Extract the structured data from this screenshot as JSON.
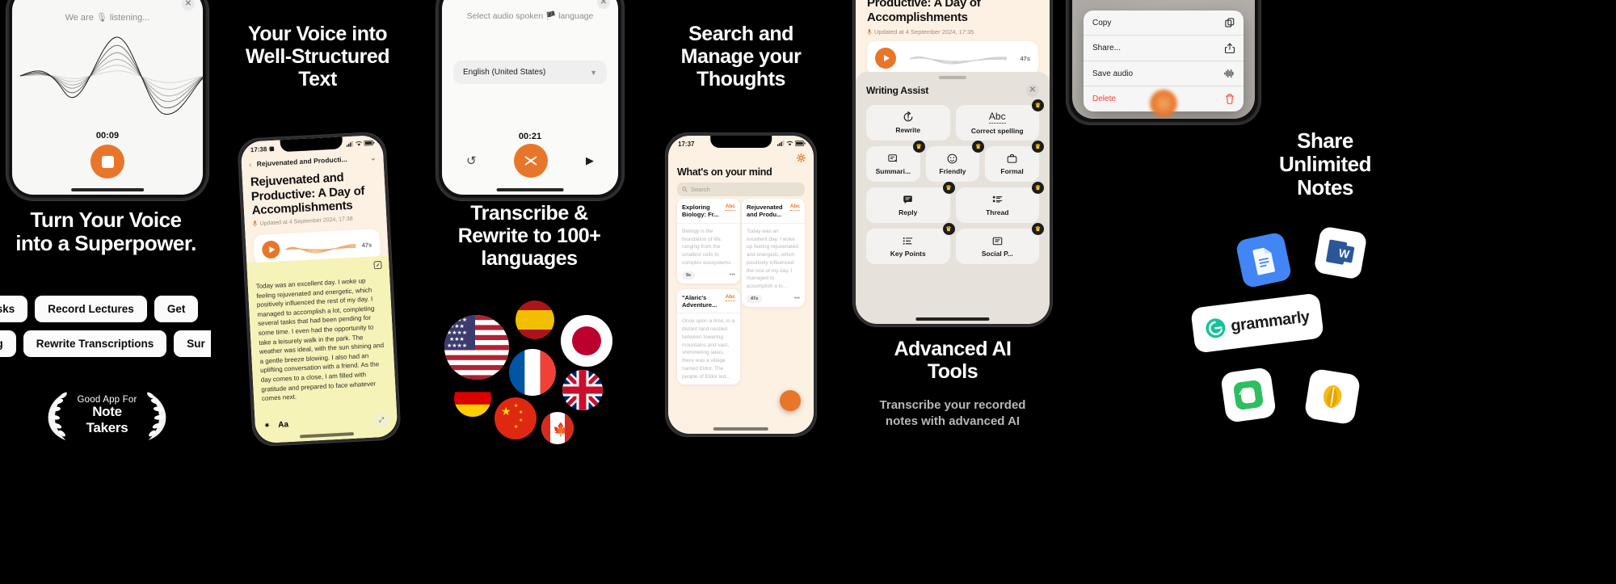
{
  "panels": [
    {
      "id": "voice-superpower",
      "headline": "Turn Your Voice\ninto a Superpower.",
      "recorder": {
        "listening_label": "We are 🎙 listening...",
        "timer": "00:09",
        "close_icon": "close-icon",
        "stop_icon": "stop-icon"
      },
      "chips": [
        "Tasks",
        "Record Lectures",
        "Get",
        "naling",
        "Rewrite Transcriptions",
        "Sur"
      ],
      "award": {
        "line1": "Good App For",
        "line2": "Note Takers"
      }
    },
    {
      "id": "voice-to-text",
      "headline": "Your Voice into\nWell-Structured\nText",
      "note": {
        "status_time": "17:38",
        "nav_back_icon": "chevron-left-icon",
        "nav_title": "Rejuvenated and Producti...",
        "nav_more_icon": "more-icon",
        "title": "Rejuvenated and Productive: A Day of Accomplishments",
        "meta_icon": "microphone-icon",
        "meta": "Updated at 4 September 2024, 17:38",
        "audio_duration": "47s",
        "play_icon": "play-icon",
        "edit_icon": "edit-icon",
        "body": "Today was an excellent day. I woke up feeling rejuvenated and energetic, which positively influenced the rest of my day. I managed to accomplish a lot, completing several tasks that had been pending for some time. I even had the opportunity to take a leisurely walk in the park. The weather was ideal, with the sun shining and a gentle breeze blowing. I also had an uplifting conversation with a friend. As the day comes to a close, I am filled with gratitude and prepared to face whatever comes next.",
        "toolbar_icons": [
          "sparkle-icon",
          "text-size-icon",
          "expand-icon"
        ],
        "toolbar_aa": "Aa"
      }
    },
    {
      "id": "transcribe-rewrite",
      "headline": "Transcribe &\nRewrite to 100+\nlanguages",
      "sheet": {
        "prompt": "Select audio spoken 🏴 language",
        "selected_language": "English (United States)",
        "dropdown_icon": "chevron-down-icon",
        "close_icon": "close-icon",
        "timer": "00:21",
        "undo_icon": "undo-icon",
        "transcribe_icon": "transcribe-icon",
        "play_icon": "play-icon"
      },
      "flags": [
        "usa",
        "spain",
        "japan",
        "france",
        "uk",
        "germany",
        "china",
        "canada"
      ]
    },
    {
      "id": "search-manage",
      "headline": "Search and\nManage your\nThoughts",
      "list": {
        "status_time": "17:37",
        "settings_icon": "gear-icon",
        "title": "What's on your mind",
        "search_placeholder": "Search",
        "search_icon": "search-icon",
        "add_icon": "plus-icon",
        "cards": [
          {
            "title": "Exploring Biology: Fr...",
            "badge": "Abc",
            "body": "Biology is the foundation of life, ranging from the smallest cells to complex ecosystems.",
            "duration": "9s",
            "more": "•••"
          },
          {
            "title": "Rejuvenated and Produ...",
            "badge": "Abc",
            "body": "Today was an excellent day. I woke up feeling rejuvenated and energetic, which positively influenced the rest of my day. I managed to accomplish a lo...",
            "duration": "47s",
            "more": "•••"
          },
          {
            "title": "\"Alaric's Adventure...",
            "badge": "Abc",
            "body": "Once upon a time, in a distant land nestled between towering mountains and vast, shimmering lakes, there was a village named Eldor. The people of Eldor led...",
            "duration": "",
            "more": ""
          }
        ]
      }
    },
    {
      "id": "advanced-ai",
      "headline": "Advanced AI\nTools",
      "subheadline": "Transcribe your recorded\nnotes with advanced AI",
      "note": {
        "title": "Productive: A Day of Accomplishments",
        "meta_icon": "microphone-icon",
        "meta": "Updated at 4 September 2024, 17:35",
        "play_icon": "play-icon",
        "audio_duration": "47s"
      },
      "writing_assist": {
        "title": "Writing Assist",
        "close_icon": "close-icon",
        "tiles": [
          {
            "label": "Rewrite",
            "icon": "rewrite-icon",
            "pro": false,
            "w": 2
          },
          {
            "label": "Correct spelling",
            "icon": "abc-icon",
            "pro": true,
            "w": 2
          },
          {
            "label": "Summari...",
            "icon": "summarize-icon",
            "pro": true,
            "w": 1
          },
          {
            "label": "Friendly",
            "icon": "smiley-icon",
            "pro": true,
            "w": 1
          },
          {
            "label": "Formal",
            "icon": "briefcase-icon",
            "pro": true,
            "w": 1
          },
          {
            "label": "Reply",
            "icon": "chat-bubble-icon",
            "pro": true,
            "w": 2
          },
          {
            "label": "Thread",
            "icon": "list-icon",
            "pro": true,
            "w": 2
          },
          {
            "label": "Key Points",
            "icon": "bullet-list-icon",
            "pro": true,
            "w": 2
          },
          {
            "label": "Social P...",
            "icon": "card-icon",
            "pro": true,
            "w": 2
          }
        ]
      }
    },
    {
      "id": "share-notes",
      "headline": "Share\nUnlimited\nNotes",
      "context_menu": [
        {
          "label": "Copy",
          "icon": "copy-icon",
          "danger": false
        },
        {
          "label": "Share...",
          "icon": "share-icon",
          "danger": false
        },
        {
          "label": "Save audio",
          "icon": "waveform-icon",
          "danger": false
        },
        {
          "label": "Delete",
          "icon": "trash-icon",
          "danger": true
        }
      ],
      "apps": [
        {
          "name": "google-docs-icon",
          "label": ""
        },
        {
          "name": "microsoft-word-icon",
          "label": ""
        },
        {
          "name": "grammarly-icon",
          "label": "grammarly"
        },
        {
          "name": "evernote-icon",
          "label": ""
        },
        {
          "name": "bear-notes-icon",
          "label": ""
        }
      ]
    }
  ],
  "colors": {
    "accent": "#e8762a",
    "bg": "#000000",
    "note_bg": "#fdf1e3",
    "note_body_bg": "#f6f3b8",
    "danger": "#ff3b30",
    "crown": "#f5c518"
  }
}
